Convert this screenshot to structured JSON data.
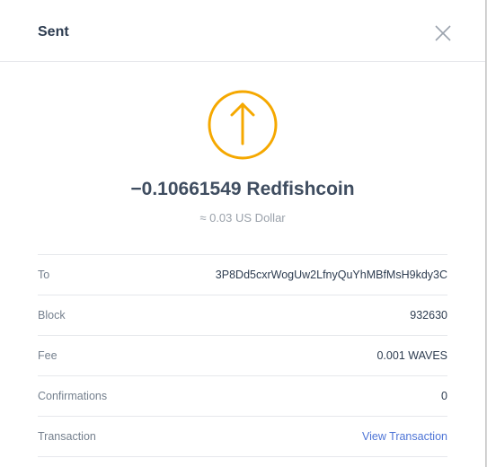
{
  "modal": {
    "title": "Sent"
  },
  "icons": {
    "close": "close-icon",
    "status": "arrow-up-circle-icon"
  },
  "colors": {
    "accent": "#f5a800",
    "link": "#4d74d6",
    "title": "#2d3c50"
  },
  "summary": {
    "amount": "−0.10661549 Redfishcoin",
    "fiat": "≈ 0.03 US Dollar"
  },
  "details": [
    {
      "label": "To",
      "value": "3P8Dd5cxrWogUw2LfnyQuYhMBfMsH9kdy3C"
    },
    {
      "label": "Block",
      "value": "932630"
    },
    {
      "label": "Fee",
      "value": "0.001 WAVES"
    },
    {
      "label": "Confirmations",
      "value": "0"
    },
    {
      "label": "Transaction",
      "value": "View Transaction"
    }
  ]
}
